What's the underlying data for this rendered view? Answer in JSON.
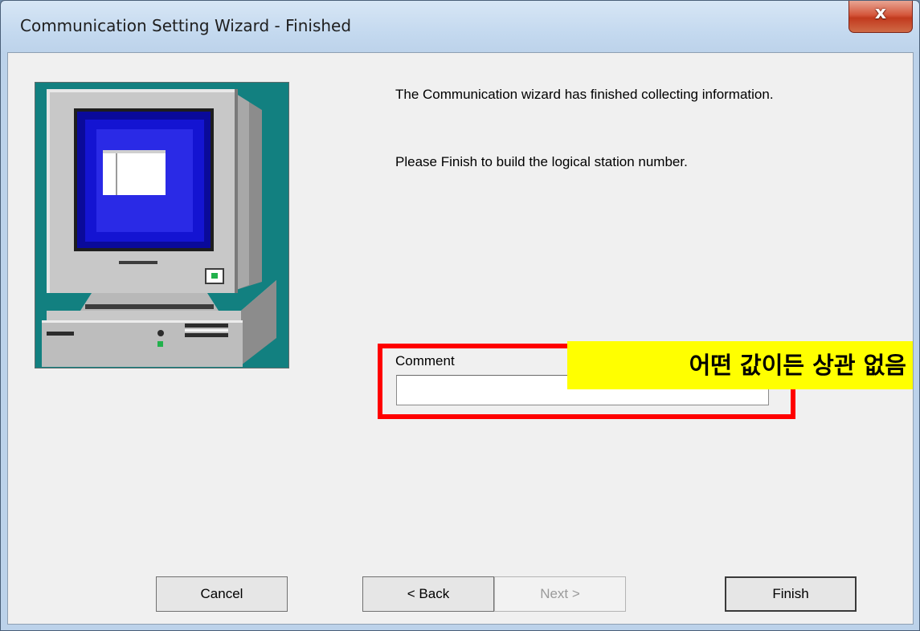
{
  "window": {
    "title": "Communication Setting Wizard - Finished",
    "close_glyph": "x"
  },
  "content": {
    "message1": "The Communication wizard has finished collecting information.",
    "message2": "Please Finish to build the logical station number.",
    "comment_label": "Comment",
    "comment_value": "",
    "image_icon": "computer-icon"
  },
  "annotation": {
    "callout_text": "어떤 값이든 상관 없음",
    "highlight_color": "#ff0000",
    "callout_background": "#ffff00"
  },
  "buttons": {
    "cancel": "Cancel",
    "back": "< Back",
    "next": "Next >",
    "finish": "Finish"
  }
}
